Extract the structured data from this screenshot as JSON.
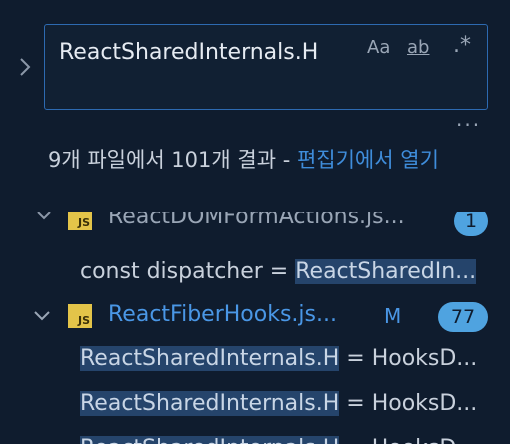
{
  "search": {
    "query": "ReactSharedInternals.H",
    "match_case_label": "Aa",
    "whole_word_label": "ab",
    "regex_label": ".*"
  },
  "summary": {
    "text": "9개 파일에서 101개 결과 - ",
    "open_in_editor": "편집기에서 열기"
  },
  "files": [
    {
      "name": "ReactDOMFormActions.js...",
      "count": "1"
    },
    {
      "name": "ReactFiberHooks.js...",
      "status": "M",
      "count": "77"
    }
  ],
  "matches": [
    {
      "prefix": "const dispatcher = ",
      "highlight": "ReactSharedIn...",
      "suffix": ""
    },
    {
      "prefix": "",
      "highlight": "ReactSharedInternals.H",
      "suffix": " = HooksD..."
    },
    {
      "prefix": "",
      "highlight": "ReactSharedInternals.H",
      "suffix": " = HooksD..."
    },
    {
      "prefix": "",
      "highlight": "ReactSharedInternals.H",
      "suffix": " = HooksD..."
    }
  ]
}
